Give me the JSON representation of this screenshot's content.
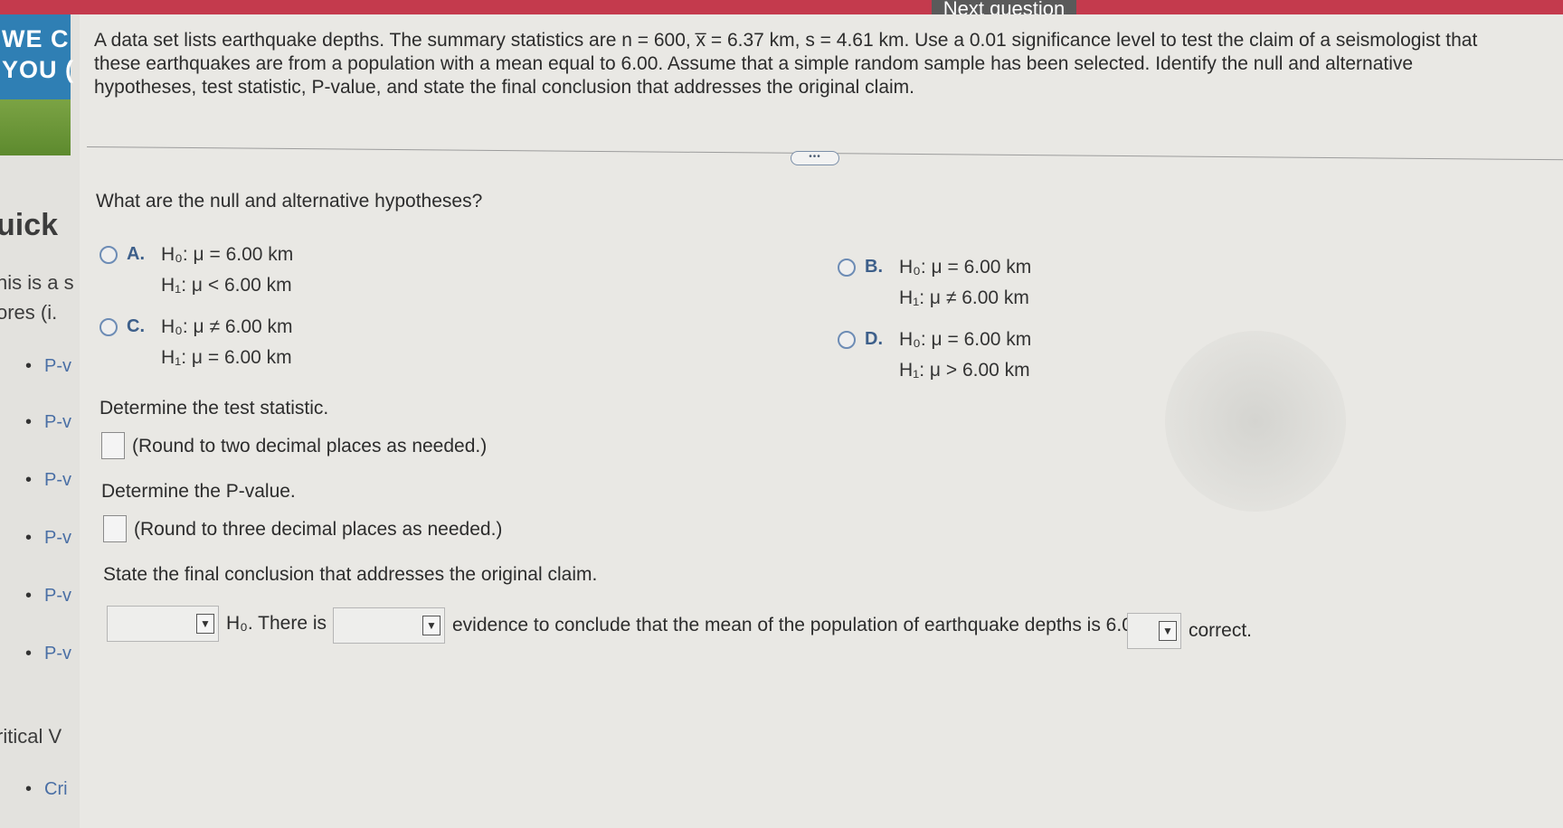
{
  "header": {
    "next_question_label": "Next question"
  },
  "sidebar": {
    "banner_line1": "WE C",
    "banner_line2": "YOU (",
    "heading": "uick",
    "text_line1": "nis is a s",
    "text_line2": "ores (i.",
    "items": [
      "P-v",
      "P-v",
      "P-v",
      "P-v",
      "P-v",
      "P-v"
    ],
    "critical_heading": "ritical V",
    "critical_item": "Cri"
  },
  "question": {
    "line1": "A data set lists earthquake depths. The summary statistics are n = 600, x̅ = 6.37 km, s = 4.61 km. Use a 0.01 significance level to test the claim of a seismologist that",
    "line2": "these earthquakes are from a population with a mean equal to 6.00. Assume that a simple random sample has been selected. Identify the null and alternative",
    "line3": "hypotheses, test statistic, P-value, and state the final conclusion that addresses the original claim.",
    "more_label": "•••"
  },
  "hypotheses_prompt": "What are the null and alternative hypotheses?",
  "options": [
    {
      "letter": "A.",
      "h0": "H₀: μ = 6.00 km",
      "h1": "H₁: μ < 6.00 km"
    },
    {
      "letter": "B.",
      "h0": "H₀: μ = 6.00 km",
      "h1": "H₁: μ ≠ 6.00 km"
    },
    {
      "letter": "C.",
      "h0": "H₀: μ ≠ 6.00 km",
      "h1": "H₁: μ = 6.00 km"
    },
    {
      "letter": "D.",
      "h0": "H₀: μ = 6.00 km",
      "h1": "H₁: μ > 6.00 km"
    }
  ],
  "test_statistic": {
    "prompt": "Determine the test statistic.",
    "hint": "(Round to two decimal places as needed.)",
    "value": ""
  },
  "p_value": {
    "prompt": "Determine the P-value.",
    "hint": "(Round to three decimal places as needed.)",
    "value": ""
  },
  "conclusion": {
    "prompt": "State the final conclusion that addresses the original claim.",
    "dropdown1_value": "",
    "text1": "H₀. There is",
    "dropdown2_value": "",
    "text2": "evidence to conclude that the mean of the population of earthquake depths is 6.00 km",
    "dropdown3_value": "",
    "text3": "correct."
  },
  "icons": {
    "dropdown_arrow": "▼"
  }
}
